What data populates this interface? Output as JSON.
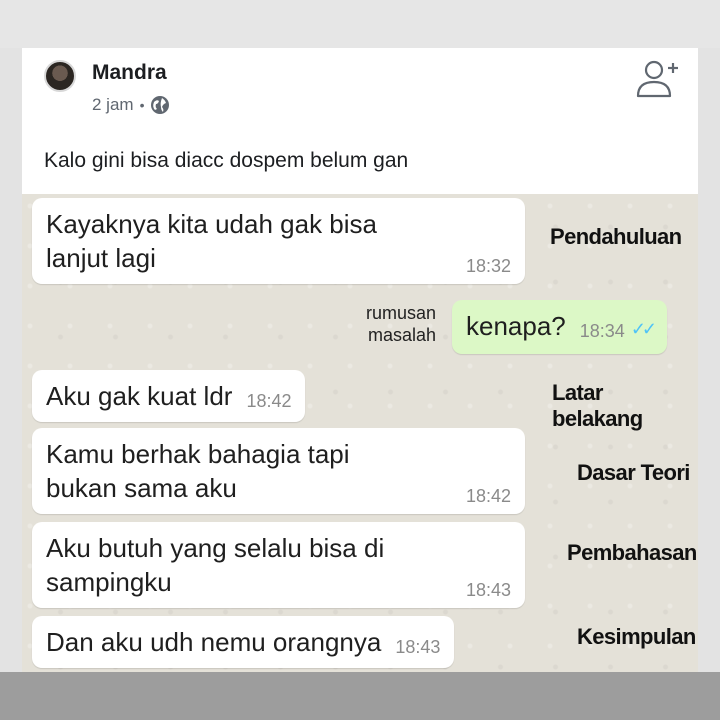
{
  "post": {
    "author": "Mandra",
    "time": "2 jam",
    "separator": "•",
    "text": "Kalo gini bisa diacc dospem belum gan"
  },
  "chat": {
    "messages": [
      {
        "text": "Kayaknya kita udah gak bisa lanjut lagi",
        "time": "18:32",
        "direction": "received"
      },
      {
        "text": "kenapa?",
        "time": "18:34",
        "direction": "sent"
      },
      {
        "text": "Aku gak kuat ldr",
        "time": "18:42",
        "direction": "received"
      },
      {
        "text": "Kamu berhak bahagia tapi bukan sama aku",
        "time": "18:42",
        "direction": "received"
      },
      {
        "text": "Aku butuh yang selalu bisa di sampingku",
        "time": "18:43",
        "direction": "received"
      },
      {
        "text": "Dan aku udh nemu orangnya",
        "time": "18:43",
        "direction": "received"
      }
    ],
    "sent_ticks": "✓✓"
  },
  "annotations": {
    "pendahuluan": "Pendahuluan",
    "rumusan_line1": "rumusan",
    "rumusan_line2": "masalah",
    "latar": "Latar belakang",
    "dasar": "Dasar Teori",
    "pembahasan": "Pembahasan",
    "kesimpulan": "Kesimpulan"
  },
  "icons": {
    "globe": "globe-icon",
    "add_friend": "add-friend-icon"
  },
  "colors": {
    "sent_bubble": "#dcf8c6",
    "received_bubble": "#ffffff",
    "chat_background": "#e4e1d8",
    "tick_blue": "#4fc3f7"
  }
}
